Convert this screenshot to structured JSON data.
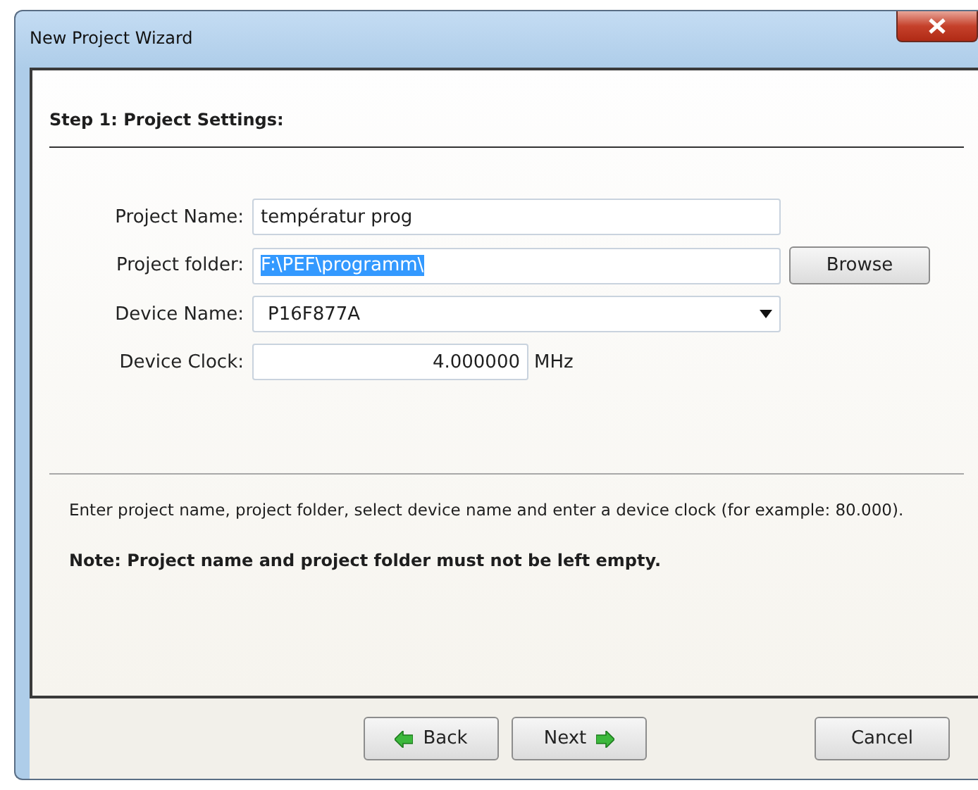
{
  "window": {
    "title": "New Project Wizard"
  },
  "step_title": "Step 1: Project Settings:",
  "fields": [
    {
      "kind": "text",
      "label": "Project Name:",
      "value": "températur prog",
      "selected_text": false
    },
    {
      "kind": "text",
      "label": "Project folder:",
      "value": "F:\\PEF\\programm\\",
      "selected_text": true,
      "button": "Browse"
    },
    {
      "kind": "dropdown",
      "label": "Device Name:",
      "value": "P16F877A"
    },
    {
      "kind": "number",
      "label": "Device Clock:",
      "value": "4.000000",
      "unit": "MHz"
    }
  ],
  "hint": "Enter project name, project folder, select device name and enter a device clock (for example: 80.000).",
  "note": "Note: Project name and project folder must not be left empty.",
  "buttons": [
    {
      "kind": "back",
      "label": "Back"
    },
    {
      "kind": "next",
      "label": "Next"
    },
    {
      "kind": "cancel",
      "label": "Cancel"
    }
  ]
}
